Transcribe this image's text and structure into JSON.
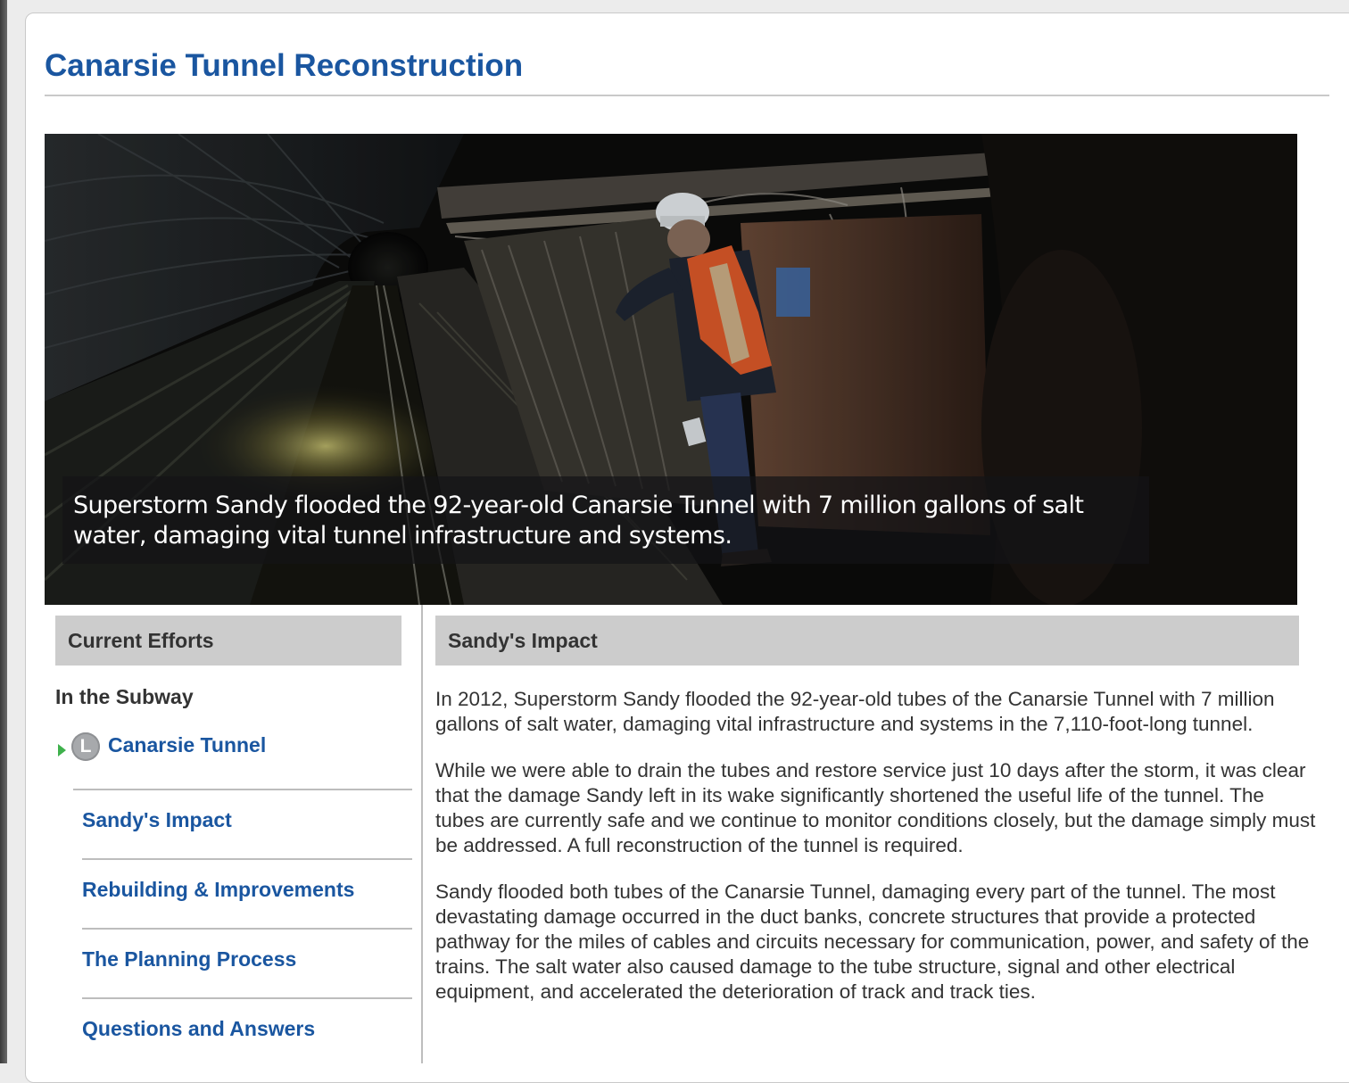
{
  "page": {
    "title": "Canarsie Tunnel Reconstruction"
  },
  "hero": {
    "caption": "Superstorm Sandy flooded the 92-year-old Canarsie Tunnel with 7 million gallons of salt water, damaging vital tunnel infrastructure and systems.",
    "image_semantic": "photo-worker-in-flooded-subway-tunnel"
  },
  "sidebar": {
    "header": "Current Efforts",
    "section_heading": "In the Subway",
    "current": {
      "badge": "L",
      "label": "Canarsie Tunnel"
    },
    "items": [
      {
        "label": "Sandy's Impact"
      },
      {
        "label": "Rebuilding & Improvements"
      },
      {
        "label": "The Planning Process"
      },
      {
        "label": "Questions and Answers"
      }
    ]
  },
  "main": {
    "header": "Sandy's Impact",
    "paragraphs": [
      "In 2012, Superstorm Sandy flooded the 92-year-old tubes of the Canarsie Tunnel with 7 million gallons of salt water, damaging vital infrastructure and systems in the 7,110-foot-long tunnel.",
      "While we were able to drain the tubes and restore service just 10 days after the storm, it was clear that the damage Sandy left in its wake significantly shortened the useful life of the tunnel.  The tubes are currently safe and we continue to monitor conditions closely, but the damage simply must be addressed. A full reconstruction of the tunnel is required.",
      "Sandy flooded both tubes of the Canarsie Tunnel, damaging every part of the tunnel. The most devastating damage occurred in the duct banks, concrete structures that provide a protected pathway for the miles of cables and circuits necessary for communication, power, and safety of the trains. The salt water also caused damage to the tube structure, signal and other electrical equipment, and accelerated the deterioration of track and track ties."
    ]
  },
  "colors": {
    "link_blue": "#1a56a0",
    "header_gray": "#cccccc",
    "text_dark": "#333333",
    "arrow_green": "#3fb14c",
    "badge_gray": "#a7a9ac"
  }
}
